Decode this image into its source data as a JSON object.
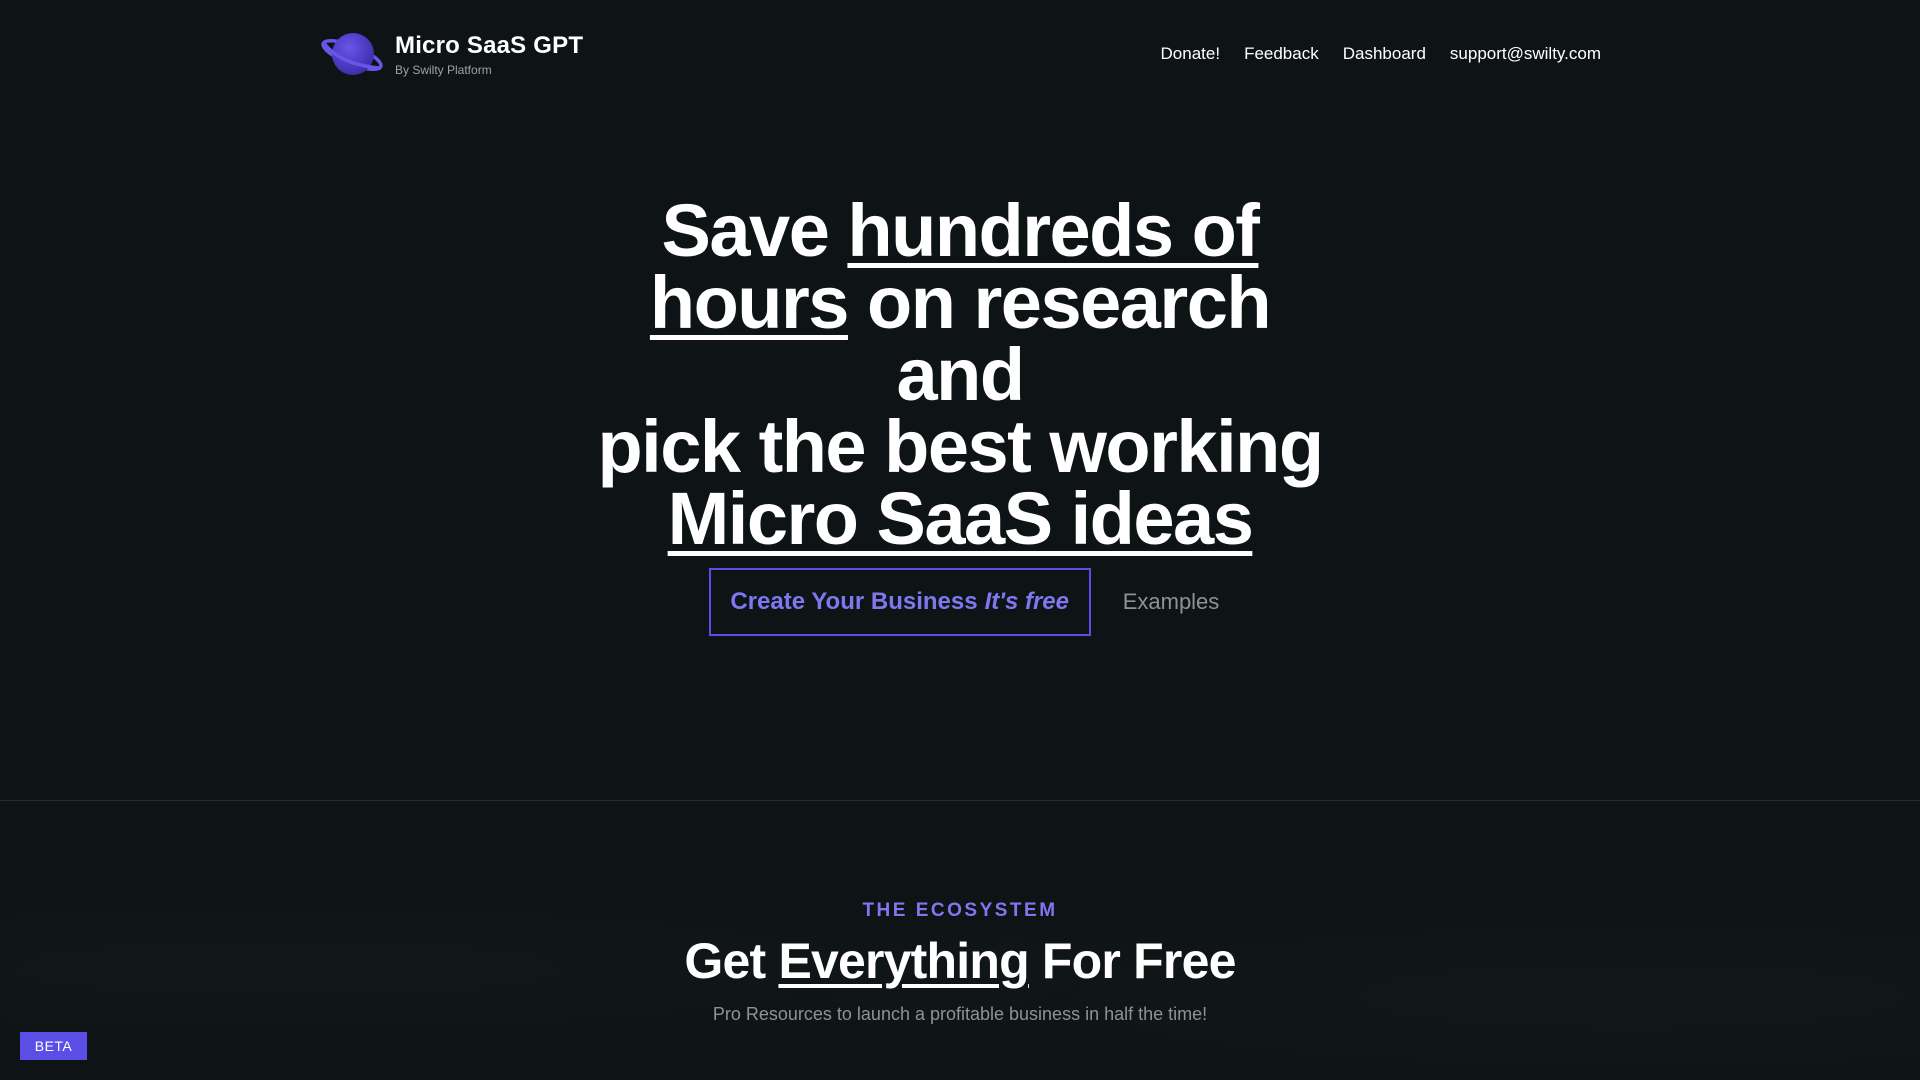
{
  "brand": {
    "title": "Micro SaaS GPT",
    "subtitle": "By Swilty Platform",
    "logo_icon": "planet-icon"
  },
  "nav": {
    "items": [
      "Donate!",
      "Feedback",
      "Dashboard",
      "support@swilty.com"
    ]
  },
  "hero": {
    "line1_a": "Save ",
    "line1_b": "hundreds of",
    "line2_a": "hours",
    "line2_b": " on research and",
    "line3": "pick the best working",
    "line4": "Micro SaaS ideas"
  },
  "cta": {
    "primary_label": "Create Your Business",
    "primary_free": "It's free",
    "secondary_label": "Examples"
  },
  "ecosystem": {
    "kicker": "THE ECOSYSTEM",
    "title_a": "Get ",
    "title_b": "Everything",
    "title_c": " For Free",
    "subtitle": "Pro Resources to launch a profitable business in half the time!"
  },
  "badge": {
    "label": "BETA"
  },
  "colors": {
    "background": "#0e1416",
    "accent": "#5b4ee6",
    "accent_text": "#7f77f0",
    "muted": "#8c9396"
  }
}
